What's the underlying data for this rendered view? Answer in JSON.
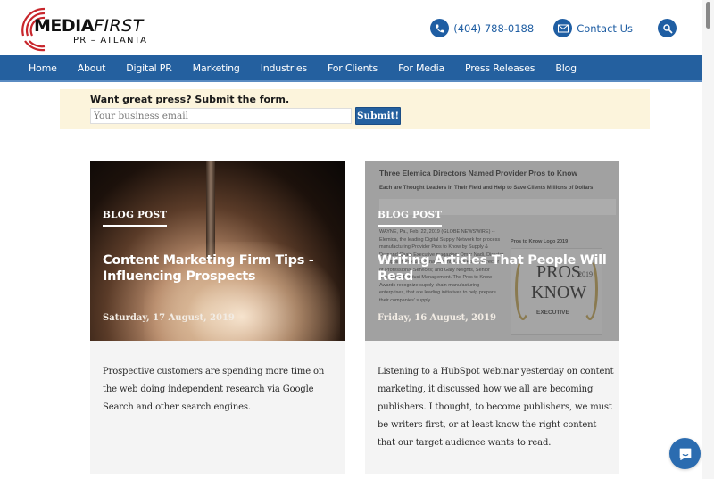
{
  "header": {
    "logo": {
      "brand_main": "MEDIA",
      "brand_accent": "FIRST",
      "subtitle": "PR – ATLANTA",
      "accent_color": "#c8262c"
    },
    "phone": {
      "icon": "phone-icon",
      "label": "(404) 788-0188"
    },
    "contact": {
      "icon": "envelope-icon",
      "label": "Contact Us"
    },
    "search": {
      "icon": "search-icon"
    },
    "icon_color": "#1f5ea3"
  },
  "nav": {
    "background": "#24609f",
    "items": [
      {
        "label": "Home"
      },
      {
        "label": "About"
      },
      {
        "label": "Digital PR"
      },
      {
        "label": "Marketing"
      },
      {
        "label": "Industries"
      },
      {
        "label": "For Clients"
      },
      {
        "label": "For Media"
      },
      {
        "label": "Press Releases"
      },
      {
        "label": "Blog"
      }
    ]
  },
  "signup": {
    "title": "Want great press? Submit the form.",
    "email_placeholder": "Your business email",
    "email_value": "",
    "submit_label": "Submit!"
  },
  "posts": [
    {
      "tag": "BLOG POST",
      "title": "Content Marketing Firm Tips - Influencing Prospects",
      "date": "Saturday, 17 August, 2019",
      "excerpt": "Prospective customers are spending more time on the web doing independent research via Google Search and other search engines.",
      "image": "rocket-launch-image"
    },
    {
      "tag": "BLOG POST",
      "title": "Writing Articles That People Will Read",
      "date": "Friday, 16 August, 2019",
      "excerpt": "Listening to a HubSpot webinar yesterday on content marketing, it discussed how we all are becoming publishers. I thought, to become publishers, we must be writers first, or at least know the right content that our target audience wants to read.",
      "image": "press-release-screenshot-image",
      "image_text": {
        "headline": "Three Elemica Directors Named Provider Pros to Know",
        "subheadline": "Each are Thought Leaders in Their Field and Help to Save Clients Millions of Dollars",
        "body": "WAYNE, Pa., Feb. 22, 2019 (GLOBE NEWSWIRE) -- Elemica, the leading Digital Supply Network for process manufacturing Provider Pros to Know by Supply & Demand Chain Executive magazine: Omar Nadi, Director of Supplier Product Management; Chris Abato, Director of Professional Services; and Gary Neights, Senior Director of Product Management. The Pros to Know Awards recognize supply chain manufacturing enterprises, that are leading initiatives to help prepare their companies' supply",
        "badge_caption": "Pros to Know Logo 2019",
        "badge_line1": "PROS",
        "badge_line2": "KNOW",
        "badge_year": "2019",
        "badge_footer": "EXECUTIVE"
      }
    }
  ],
  "chat": {
    "icon": "chat-bubble-icon",
    "color": "#2b6cb0"
  }
}
